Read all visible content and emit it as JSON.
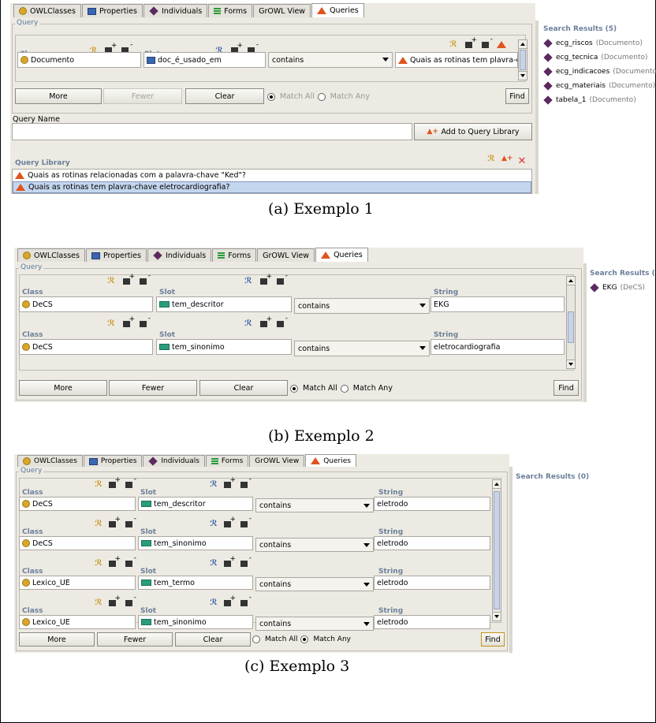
{
  "tabs": [
    "OWLClasses",
    "Properties",
    "Individuals",
    "Forms",
    "GrOWL View",
    "Queries"
  ],
  "labels": {
    "query": "Query",
    "class": "Class",
    "slot": "Slot",
    "string": "String",
    "more": "More",
    "fewer": "Fewer",
    "clear": "Clear",
    "find": "Find",
    "match_all": "Match All",
    "match_any": "Match Any",
    "query_name": "Query Name",
    "add_to_library": "Add to Query Library",
    "query_library": "Query Library"
  },
  "example1": {
    "caption": "(a) Exemplo 1",
    "row": {
      "class": "Documento",
      "slot": "doc_é_usado_em",
      "op": "contains",
      "value": "Quais as rotinas tem plavra-cl..."
    },
    "library": [
      "Quais as rotinas relacionadas com a palavra-chave \"Ked\"?",
      "Quais as rotinas tem plavra-chave eletrocardiografia?"
    ],
    "results_title": "Search Results (5)",
    "results": [
      {
        "name": "ecg_riscos",
        "type": "(Documento)"
      },
      {
        "name": "ecg_tecnica",
        "type": "(Documento)"
      },
      {
        "name": "ecg_indicacoes",
        "type": "(Documento)"
      },
      {
        "name": "ecg_materiais",
        "type": "(Documento)"
      },
      {
        "name": "tabela_1",
        "type": "(Documento)"
      }
    ]
  },
  "example2": {
    "caption": "(b) Exemplo 2",
    "rows": [
      {
        "class": "DeCS",
        "slot": "tem_descritor",
        "op": "contains",
        "value": "EKG"
      },
      {
        "class": "DeCS",
        "slot": "tem_sinonimo",
        "op": "contains",
        "value": "eletrocardiografia"
      }
    ],
    "results_title": "Search Results (",
    "results": [
      {
        "name": "EKG",
        "type": "(DeCS)"
      }
    ]
  },
  "example3": {
    "caption": "(c) Exemplo 3",
    "rows": [
      {
        "class": "DeCS",
        "slot": "tem_descritor",
        "op": "contains",
        "value": "eletrodo"
      },
      {
        "class": "DeCS",
        "slot": "tem_sinonimo",
        "op": "contains",
        "value": "eletrodo"
      },
      {
        "class": "Lexico_UE",
        "slot": "tem_termo",
        "op": "contains",
        "value": "eletrodo"
      },
      {
        "class": "Lexico_UE",
        "slot": "tem_sinonimo",
        "op": "contains",
        "value": "eletrodo"
      }
    ],
    "results_title": "Search Results (0)"
  }
}
